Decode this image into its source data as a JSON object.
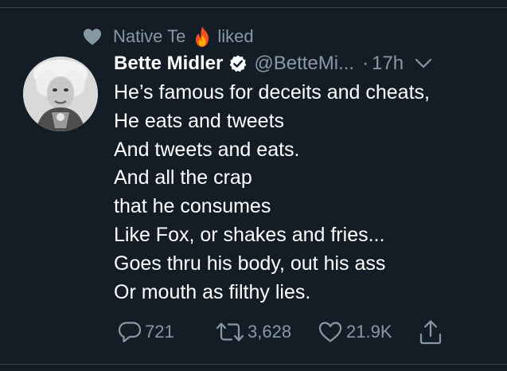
{
  "social_context": {
    "liker_name": "Native Te",
    "action": "liked"
  },
  "tweet": {
    "display_name": "Bette Midler",
    "handle": "@BetteMi...",
    "separator": "·",
    "time": "17h",
    "lines": [
      "He’s famous for deceits and cheats,",
      "He eats and tweets",
      "And tweets and eats.",
      "And all the crap",
      "that he consumes",
      "Like Fox, or shakes and fries...",
      "Goes thru his body, out his ass",
      "Or mouth as filthy lies."
    ]
  },
  "actions": {
    "replies": "721",
    "retweets": "3,628",
    "likes": "21.9K"
  },
  "icons": {
    "social_context": "heart-icon",
    "liker_emoji": "fire-icon",
    "verified": "verified-badge-icon",
    "menu": "chevron-down-icon",
    "reply": "reply-icon",
    "retweet": "retweet-icon",
    "like": "like-icon",
    "share": "share-icon"
  },
  "colors": {
    "background": "#141d26",
    "text": "#ffffff",
    "secondary_text": "#8899a6",
    "divider": "#38444d"
  }
}
